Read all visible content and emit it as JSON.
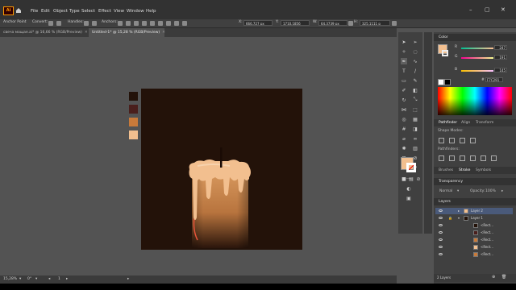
{
  "app": {
    "logo": "Ai"
  },
  "menu": [
    "File",
    "Edit",
    "Object",
    "Type",
    "Select",
    "Effect",
    "View",
    "Window",
    "Help"
  ],
  "control_bar": {
    "anchor_point_label": "Anchor Point",
    "convert_label": "Convert:",
    "handles_label": "Handles:",
    "anchors_label": "Anchors:",
    "x_value": "666,727 px",
    "y_value": "1710,1856",
    "w_value": "64,3739 px",
    "h_value": "325,1111 p"
  },
  "document_tabs": [
    {
      "label": "свеча мощая.ai* @ 16,66 % (RGB/Preview)",
      "active": false
    },
    {
      "label": "Untitled-1* @ 15,28 % (RGB/Preview)",
      "active": true
    }
  ],
  "swatches": [
    "#231209",
    "#4a1f1c",
    "#c87a3a",
    "#f2bf8f"
  ],
  "status": {
    "zoom": "15,28%",
    "angle": "0°",
    "page": "1"
  },
  "color_panel": {
    "title": "Color",
    "r": "247",
    "g": "191",
    "b": "145",
    "hex": "F7C291",
    "fill_color": "#f2bf8f"
  },
  "pathfinder": {
    "tabs": [
      "Pathfinder",
      "Align",
      "Transform"
    ],
    "shape_modes_label": "Shape Modes:",
    "pathfinders_label": "Pathfinders:"
  },
  "brushes_tabs": [
    "Brushes",
    "Stroke",
    "Symbols"
  ],
  "transparency": {
    "title": "Transparency",
    "mode": "Normal",
    "opacity_label": "Opacity:",
    "opacity_value": "100%"
  },
  "layers": {
    "title": "Layers",
    "rows": [
      {
        "name": "Layer 2"
      },
      {
        "name": "Layer 1"
      },
      {
        "name": "<Rect..."
      },
      {
        "name": "<Rect..."
      },
      {
        "name": "<Rect..."
      },
      {
        "name": "<Rect..."
      },
      {
        "name": "<Rect..."
      }
    ],
    "count": "2 Layers"
  }
}
